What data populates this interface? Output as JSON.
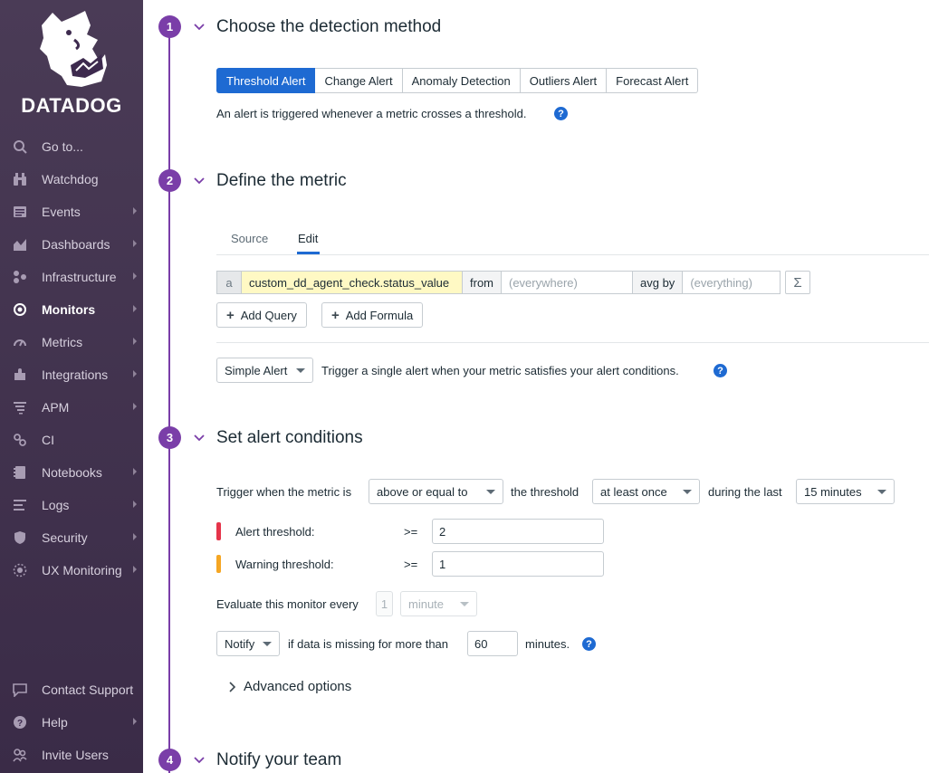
{
  "brand": {
    "name": "DATADOG"
  },
  "sidebar": {
    "items": [
      {
        "label": "Go to...",
        "icon": "search-icon",
        "arrow": false
      },
      {
        "label": "Watchdog",
        "icon": "binoculars-icon",
        "arrow": false
      },
      {
        "label": "Events",
        "icon": "events-icon",
        "arrow": true
      },
      {
        "label": "Dashboards",
        "icon": "dashboards-icon",
        "arrow": true
      },
      {
        "label": "Infrastructure",
        "icon": "infrastructure-icon",
        "arrow": true
      },
      {
        "label": "Monitors",
        "icon": "monitors-icon",
        "arrow": true,
        "active": true
      },
      {
        "label": "Metrics",
        "icon": "metrics-icon",
        "arrow": true
      },
      {
        "label": "Integrations",
        "icon": "puzzle-icon",
        "arrow": true
      },
      {
        "label": "APM",
        "icon": "apm-icon",
        "arrow": true
      },
      {
        "label": "CI",
        "icon": "ci-icon",
        "arrow": false
      },
      {
        "label": "Notebooks",
        "icon": "notebook-icon",
        "arrow": true
      },
      {
        "label": "Logs",
        "icon": "logs-icon",
        "arrow": true
      },
      {
        "label": "Security",
        "icon": "shield-icon",
        "arrow": true
      },
      {
        "label": "UX Monitoring",
        "icon": "ux-icon",
        "arrow": true
      }
    ],
    "bottom_items": [
      {
        "label": "Contact Support",
        "icon": "chat-icon",
        "arrow": false
      },
      {
        "label": "Help",
        "icon": "help-icon",
        "arrow": true
      },
      {
        "label": "Invite Users",
        "icon": "users-icon",
        "arrow": false
      }
    ]
  },
  "steps": {
    "s1": {
      "num": "1",
      "title": "Choose the detection method"
    },
    "s2": {
      "num": "2",
      "title": "Define the metric"
    },
    "s3": {
      "num": "3",
      "title": "Set alert conditions"
    },
    "s4": {
      "num": "4",
      "title": "Notify your team"
    }
  },
  "detection": {
    "methods": [
      "Threshold Alert",
      "Change Alert",
      "Anomaly Detection",
      "Outliers Alert",
      "Forecast Alert"
    ],
    "selected": "Threshold Alert",
    "description": "An alert is triggered whenever a metric crosses a threshold."
  },
  "metric": {
    "tabs": {
      "source": "Source",
      "edit": "Edit"
    },
    "active_tab": "Edit",
    "query": {
      "letter": "a",
      "metric_name": "custom_dd_agent_check.status_value",
      "from_label": "from",
      "from_placeholder": "(everywhere)",
      "avg_by_label": "avg by",
      "avg_by_placeholder": "(everything)",
      "sigma": "Σ"
    },
    "add_query_label": "Add Query",
    "add_formula_label": "Add Formula",
    "alert_type": "Simple Alert",
    "alert_type_description": "Trigger a single alert when your metric satisfies your alert conditions."
  },
  "conditions": {
    "trigger_prefix": "Trigger when the metric is",
    "comparator": "above or equal to",
    "threshold_label": "the threshold",
    "occurrence": "at least once",
    "during_label": "during the last",
    "window": "15 minutes",
    "alert_threshold_label": "Alert threshold:",
    "alert_op": ">=",
    "alert_value": "2",
    "warning_threshold_label": "Warning threshold:",
    "warning_op": ">=",
    "warning_value": "1",
    "evaluate_label": "Evaluate this monitor every",
    "evaluate_value": "1",
    "evaluate_unit": "minute",
    "missing_action": "Notify",
    "missing_text": "if data is missing for more than",
    "missing_value": "60",
    "missing_unit": "minutes.",
    "advanced_label": "Advanced options",
    "alert_color": "#e5344a",
    "warning_color": "#f5a623"
  },
  "colors": {
    "accent": "#7a3ea8",
    "primary": "#1e6ad2"
  }
}
